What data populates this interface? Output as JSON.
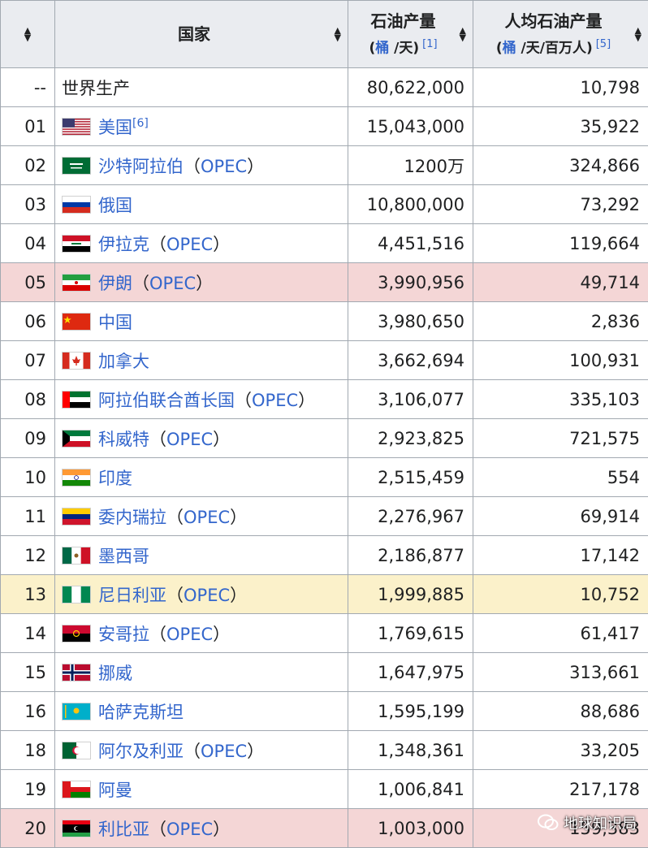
{
  "header": {
    "col_rank": "",
    "col_country": "国家",
    "col_production": "石油产量",
    "col_production_unit_a": "桶",
    "col_production_unit_b": " /天)",
    "col_production_unit_open": "(",
    "col_production_ref": "[1]",
    "col_per_capita": "人均石油产量",
    "col_per_capita_unit_open": "(",
    "col_per_capita_unit_a": "桶",
    "col_per_capita_unit_b": " /天/百万人)",
    "col_per_capita_ref": "[5]"
  },
  "rows": [
    {
      "rank": "--",
      "name": "世界生产",
      "link": false,
      "flag": "none",
      "opec": "",
      "ref": "",
      "production": "80,622,000",
      "per_capita": "10,798",
      "highlight": "none"
    },
    {
      "rank": "01",
      "name": "美国",
      "link": true,
      "flag": "us",
      "opec": "",
      "ref": "[6]",
      "production": "15,043,000",
      "per_capita": "35,922",
      "highlight": "none"
    },
    {
      "rank": "02",
      "name": "沙特阿拉伯",
      "link": true,
      "flag": "sa",
      "opec": "OPEC",
      "ref": "",
      "production": "1200万",
      "per_capita": "324,866",
      "highlight": "none"
    },
    {
      "rank": "03",
      "name": "俄国",
      "link": true,
      "flag": "ru",
      "opec": "",
      "ref": "",
      "production": "10,800,000",
      "per_capita": "73,292",
      "highlight": "none"
    },
    {
      "rank": "04",
      "name": "伊拉克",
      "link": true,
      "flag": "iq",
      "opec": "OPEC",
      "ref": "",
      "production": "4,451,516",
      "per_capita": "119,664",
      "highlight": "none"
    },
    {
      "rank": "05",
      "name": "伊朗",
      "link": true,
      "flag": "ir",
      "opec": "OPEC",
      "ref": "",
      "production": "3,990,956",
      "per_capita": "49,714",
      "highlight": "pink"
    },
    {
      "rank": "06",
      "name": "中国",
      "link": true,
      "flag": "cn",
      "opec": "",
      "ref": "",
      "production": "3,980,650",
      "per_capita": "2,836",
      "highlight": "none"
    },
    {
      "rank": "07",
      "name": "加拿大",
      "link": true,
      "flag": "ca",
      "opec": "",
      "ref": "",
      "production": "3,662,694",
      "per_capita": "100,931",
      "highlight": "none"
    },
    {
      "rank": "08",
      "name": "阿拉伯联合酋长国",
      "link": true,
      "flag": "ae",
      "opec": "OPEC",
      "ref": "",
      "production": "3,106,077",
      "per_capita": "335,103",
      "highlight": "none"
    },
    {
      "rank": "09",
      "name": "科威特",
      "link": true,
      "flag": "kw",
      "opec": "OPEC",
      "ref": "",
      "production": "2,923,825",
      "per_capita": "721,575",
      "highlight": "none"
    },
    {
      "rank": "10",
      "name": "印度",
      "link": true,
      "flag": "in",
      "opec": "",
      "ref": "",
      "production": "2,515,459",
      "per_capita": "554",
      "highlight": "none"
    },
    {
      "rank": "11",
      "name": "委内瑞拉",
      "link": true,
      "flag": "ve",
      "opec": "OPEC",
      "ref": "",
      "production": "2,276,967",
      "per_capita": "69,914",
      "highlight": "none"
    },
    {
      "rank": "12",
      "name": "墨西哥",
      "link": true,
      "flag": "mx",
      "opec": "",
      "ref": "",
      "production": "2,186,877",
      "per_capita": "17,142",
      "highlight": "none"
    },
    {
      "rank": "13",
      "name": "尼日利亚",
      "link": true,
      "flag": "ng",
      "opec": "OPEC",
      "ref": "",
      "production": "1,999,885",
      "per_capita": "10,752",
      "highlight": "yellow"
    },
    {
      "rank": "14",
      "name": "安哥拉",
      "link": true,
      "flag": "ao",
      "opec": "OPEC",
      "ref": "",
      "production": "1,769,615",
      "per_capita": "61,417",
      "highlight": "none"
    },
    {
      "rank": "15",
      "name": "挪威",
      "link": true,
      "flag": "no",
      "opec": "",
      "ref": "",
      "production": "1,647,975",
      "per_capita": "313,661",
      "highlight": "none"
    },
    {
      "rank": "16",
      "name": "哈萨克斯坦",
      "link": true,
      "flag": "kz",
      "opec": "",
      "ref": "",
      "production": "1,595,199",
      "per_capita": "88,686",
      "highlight": "none"
    },
    {
      "rank": "18",
      "name": "阿尔及利亚",
      "link": true,
      "flag": "dz",
      "opec": "OPEC",
      "ref": "",
      "production": "1,348,361",
      "per_capita": "33,205",
      "highlight": "none"
    },
    {
      "rank": "19",
      "name": "阿曼",
      "link": true,
      "flag": "om",
      "opec": "",
      "ref": "",
      "production": "1,006,841",
      "per_capita": "217,178",
      "highlight": "none"
    },
    {
      "rank": "20",
      "name": "利比亚",
      "link": true,
      "flag": "ly",
      "opec": "OPEC",
      "ref": "",
      "production": "1,003,000",
      "per_capita": "159,383",
      "highlight": "pink"
    }
  ],
  "watermark": "地球知识局",
  "colors": {
    "link": "#3366cc",
    "header_bg": "#eaecf0",
    "border": "#a2a9b1",
    "pink_row": "#f4d6d6",
    "yellow_row": "#fbf1ca"
  }
}
